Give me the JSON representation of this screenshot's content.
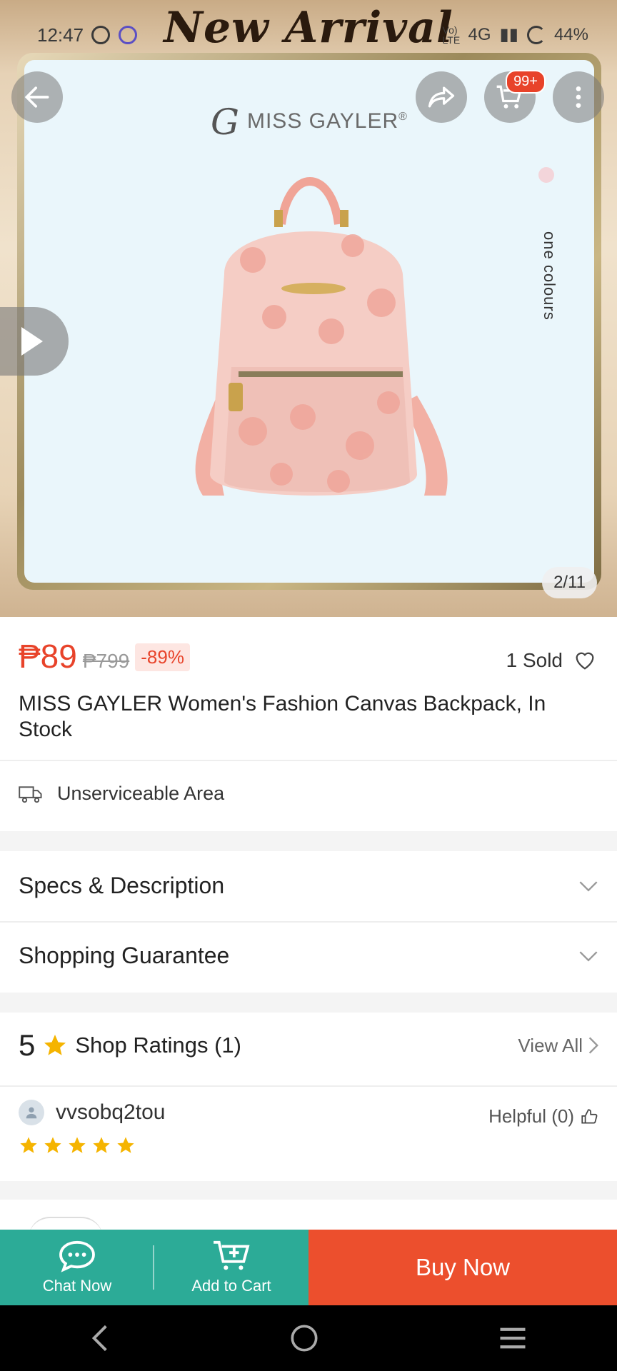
{
  "status_bar": {
    "time": "12:47",
    "network": "4G",
    "volte": "Vo) LTE",
    "battery": "44%"
  },
  "hero": {
    "banner_title": "New Arrival",
    "brand_name": "MISS GAYLER",
    "brand_mark": "®",
    "side_text": "one colours",
    "cart_badge": "99+",
    "image_counter": "2/11",
    "product_colors": {
      "bag": "#f1c4bc",
      "bg": "#eaf6fb"
    }
  },
  "product": {
    "price": "₱89",
    "original_price": "₱799",
    "discount": "-89%",
    "sold": "1 Sold",
    "title": "MISS GAYLER Women's Fashion Canvas Backpack, In Stock"
  },
  "shipping": {
    "icon": "truck-icon",
    "label": "Unserviceable Area"
  },
  "sections": {
    "specs": "Specs & Description",
    "guarantee": "Shopping Guarantee"
  },
  "ratings": {
    "score": "5",
    "label": "Shop Ratings (1)",
    "view_all": "View All"
  },
  "review": {
    "username": "vvsobq2tou",
    "helpful": "Helpful (0)",
    "stars": 5
  },
  "bottom_bar": {
    "chat": "Chat Now",
    "cart": "Add to Cart",
    "buy": "Buy Now"
  },
  "colors": {
    "accent_red": "#e8432a",
    "teal": "#2cab97",
    "buy_orange": "#ec4f2d",
    "star": "#f5b400"
  }
}
